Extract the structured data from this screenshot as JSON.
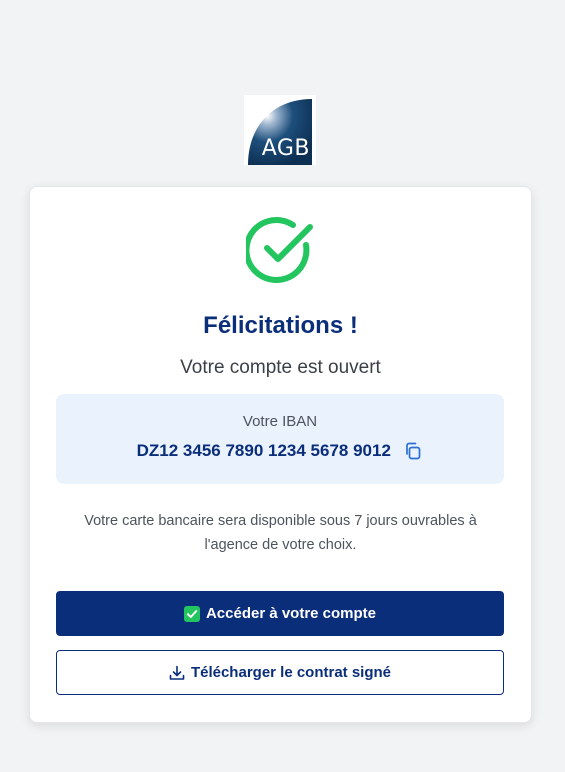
{
  "logo": {
    "text": "AGB"
  },
  "success": {
    "icon": "check-circle-icon",
    "title": "Félicitations !",
    "subtitle": "Votre compte est ouvert"
  },
  "iban": {
    "label": "Votre IBAN",
    "value": "DZ12 3456 7890 1234 5678 9012",
    "copy_icon": "copy-icon"
  },
  "info": {
    "text": "Votre carte bancaire sera disponible sous 7 jours ouvrables à l'agence de votre choix."
  },
  "actions": {
    "primary_label": "Accéder à votre compte",
    "primary_icon": "checkbox-checked-icon",
    "secondary_label": "Télécharger le contrat signé",
    "secondary_icon": "download-icon"
  },
  "colors": {
    "brand_navy": "#0b2e7a",
    "success_green": "#22c55e",
    "iban_bg": "#eaf3fd",
    "page_bg": "#f2f3f5"
  }
}
